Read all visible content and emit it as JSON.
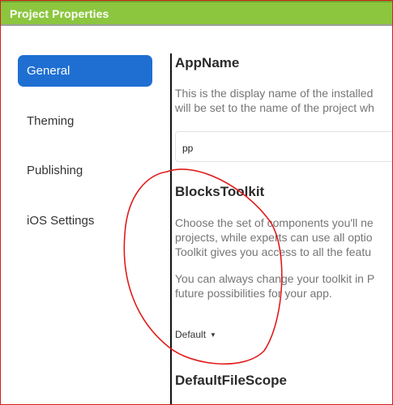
{
  "dialog": {
    "title": "Project Properties"
  },
  "sidebar": {
    "items": [
      {
        "label": "General"
      },
      {
        "label": "Theming"
      },
      {
        "label": "Publishing"
      },
      {
        "label": "iOS Settings"
      }
    ]
  },
  "sections": {
    "app_name": {
      "title": "AppName",
      "desc_line1": "This is the display name of the installed",
      "desc_line2": "will be set to the name of the project wh",
      "value": "pp"
    },
    "blocks_toolkit": {
      "title": "BlocksToolkit",
      "para1_line1": "Choose the set of components you'll ne",
      "para1_line2": "projects, while experts can use all optio",
      "para1_line3": "Toolkit gives you access to all the featu",
      "para2_line1": "You can always change your toolkit in P",
      "para2_line2": "future possibilities for your app.",
      "selected": "Default"
    },
    "default_file_scope": {
      "title": "DefaultFileScope"
    }
  },
  "colors": {
    "titlebar": "#8cc63f",
    "active_nav": "#1f6fd2",
    "annotation": "#e01b1b"
  }
}
